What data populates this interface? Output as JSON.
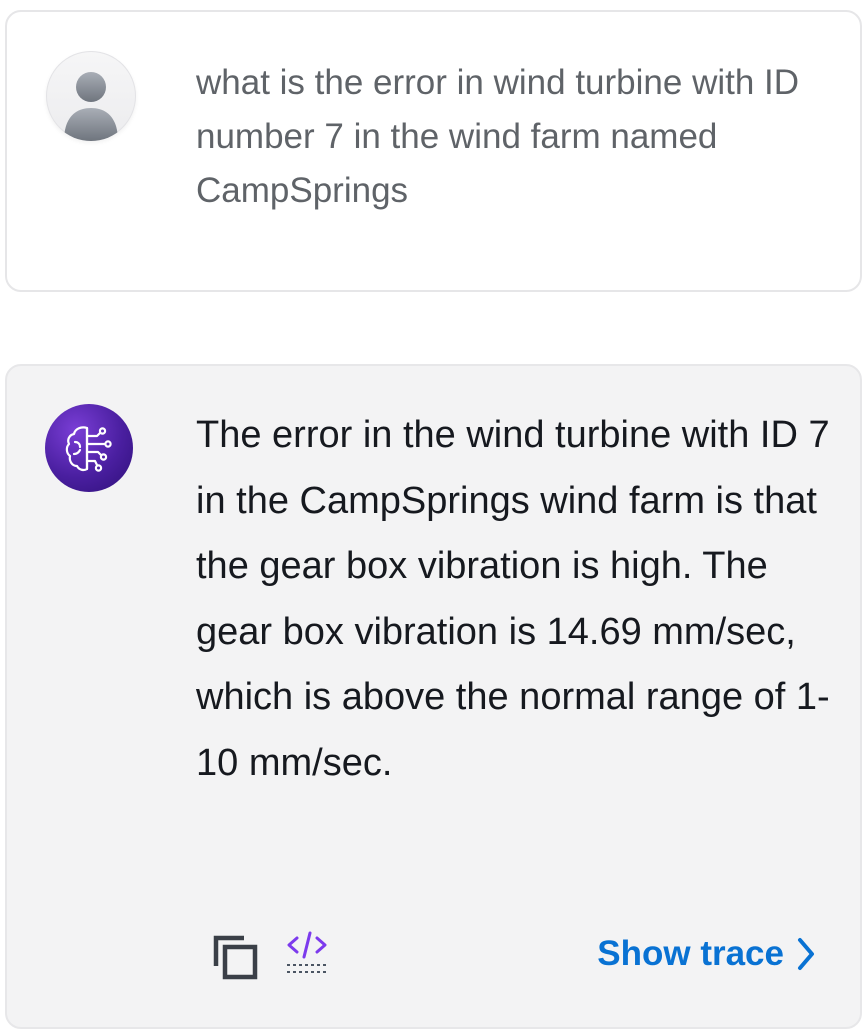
{
  "user_message": {
    "text": "what is the error in wind turbine with ID number 7 in the wind farm named CampSprings",
    "avatar_icon": "user-avatar-icon"
  },
  "assistant_message": {
    "text": "The error in the wind turbine with ID 7 in the CampSprings wind farm is that the gear box vibration is high. The gear box vibration is 14.69 mm/sec, which is above the normal range of 1-10 mm/sec.",
    "avatar_icon": "ai-brain-icon",
    "actions": {
      "copy_icon": "copy-icon",
      "code_icon": "code-icon",
      "show_trace_label": "Show trace",
      "show_trace_icon": "chevron-right-icon"
    }
  },
  "colors": {
    "link": "#0972d3",
    "bot_avatar": "#4a1fa0",
    "code_icon": "#7c3aed",
    "assistant_bg": "#f3f3f4"
  }
}
